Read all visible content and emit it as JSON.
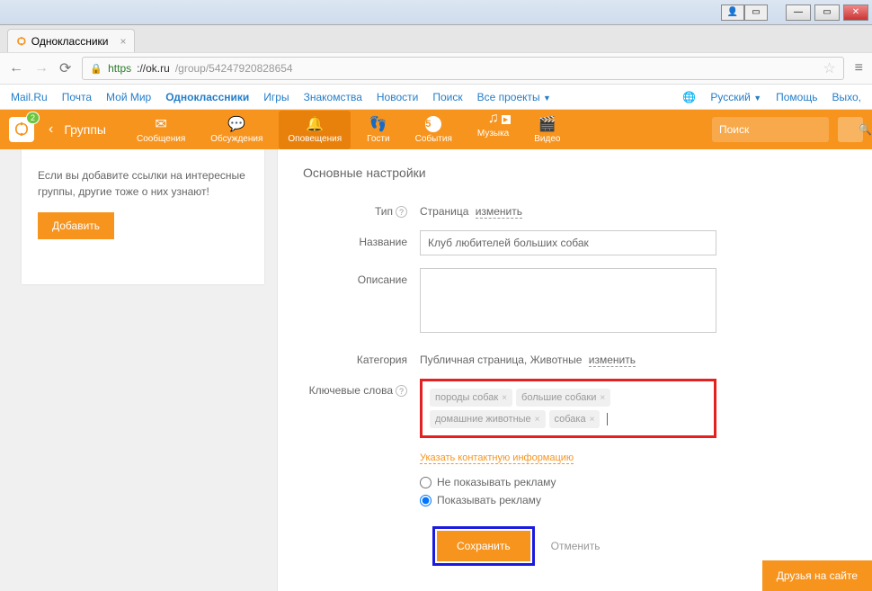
{
  "browser": {
    "tab_title": "Одноклассники",
    "url_proto": "https",
    "url_host": "://ok.ru",
    "url_path": "/group/54247920828654"
  },
  "mailru": {
    "items": [
      "Mail.Ru",
      "Почта",
      "Мой Мир",
      "Одноклассники",
      "Игры",
      "Знакомства",
      "Новости",
      "Поиск",
      "Все проекты"
    ],
    "active_index": 3,
    "lang": "Русский",
    "help": "Помощь",
    "logout": "Выхо,"
  },
  "orange_nav": {
    "badge": "2",
    "groups_label": "Группы",
    "items": [
      {
        "icon": "✉",
        "label": "Сообщения"
      },
      {
        "icon": "💬",
        "label": "Обсуждения"
      },
      {
        "icon": "🔔",
        "label": "Оповещения"
      },
      {
        "icon": "👣",
        "label": "Гости"
      },
      {
        "icon": "5",
        "label": "События"
      },
      {
        "icon": "♫",
        "label": "Музыка"
      },
      {
        "icon": "🎬",
        "label": "Видео"
      }
    ],
    "search_placeholder": "Поиск"
  },
  "sidebar": {
    "text": "Если вы добавите ссылки на интересные группы, другие тоже о них узнают!",
    "button": "Добавить"
  },
  "panel": {
    "title": "Основные настройки",
    "type_label": "Тип",
    "type_value": "Страница",
    "change_link": "изменить",
    "name_label": "Название",
    "name_value": "Клуб любителей больших собак",
    "desc_label": "Описание",
    "category_label": "Категория",
    "category_value": "Публичная страница, Животные",
    "keywords_label": "Ключевые слова",
    "tags": [
      "породы собак",
      "большие собаки",
      "домашние животные",
      "собака"
    ],
    "contact_link": "Указать контактную информацию",
    "radio_no_ads": "Не показывать рекламу",
    "radio_ads": "Показывать рекламу",
    "save_button": "Сохранить",
    "cancel_button": "Отменить",
    "friends_tab": "Друзья на сайте"
  }
}
